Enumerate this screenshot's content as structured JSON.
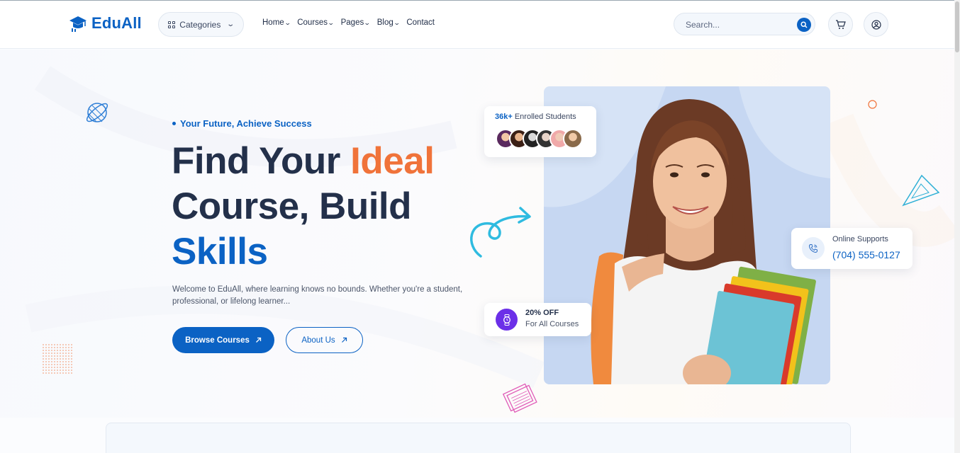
{
  "header": {
    "logo_text": "EduAll",
    "categories_label": "Categories",
    "nav": [
      {
        "label": "Home",
        "has_dropdown": true
      },
      {
        "label": "Courses",
        "has_dropdown": true
      },
      {
        "label": "Pages",
        "has_dropdown": true
      },
      {
        "label": "Blog",
        "has_dropdown": true
      },
      {
        "label": "Contact",
        "has_dropdown": false
      }
    ],
    "search_placeholder": "Search...",
    "icons": [
      "search-icon",
      "cart-icon",
      "user-icon"
    ]
  },
  "hero": {
    "tagline": "Your Future, Achieve Success",
    "headline_part1": "Find Your ",
    "headline_highlight1": "Ideal",
    "headline_part2": "Course, Build",
    "headline_highlight2": "Skills",
    "description": "Welcome to EduAll, where learning knows no bounds. Whether you're a student, professional, or lifelong learner...",
    "primary_button": "Browse Courses",
    "secondary_button": "About Us"
  },
  "students_card": {
    "count": "36k+",
    "label": "Enrolled Students"
  },
  "support_card": {
    "label": "Online Supports",
    "phone": "(704) 555-0127"
  },
  "discount_card": {
    "title": "20% OFF",
    "subtitle": "For All Courses"
  },
  "colors": {
    "primary": "#0b62c4",
    "accent": "#f0733a",
    "discount_icon": "#6b2fe8",
    "text_dark": "#23304a"
  }
}
